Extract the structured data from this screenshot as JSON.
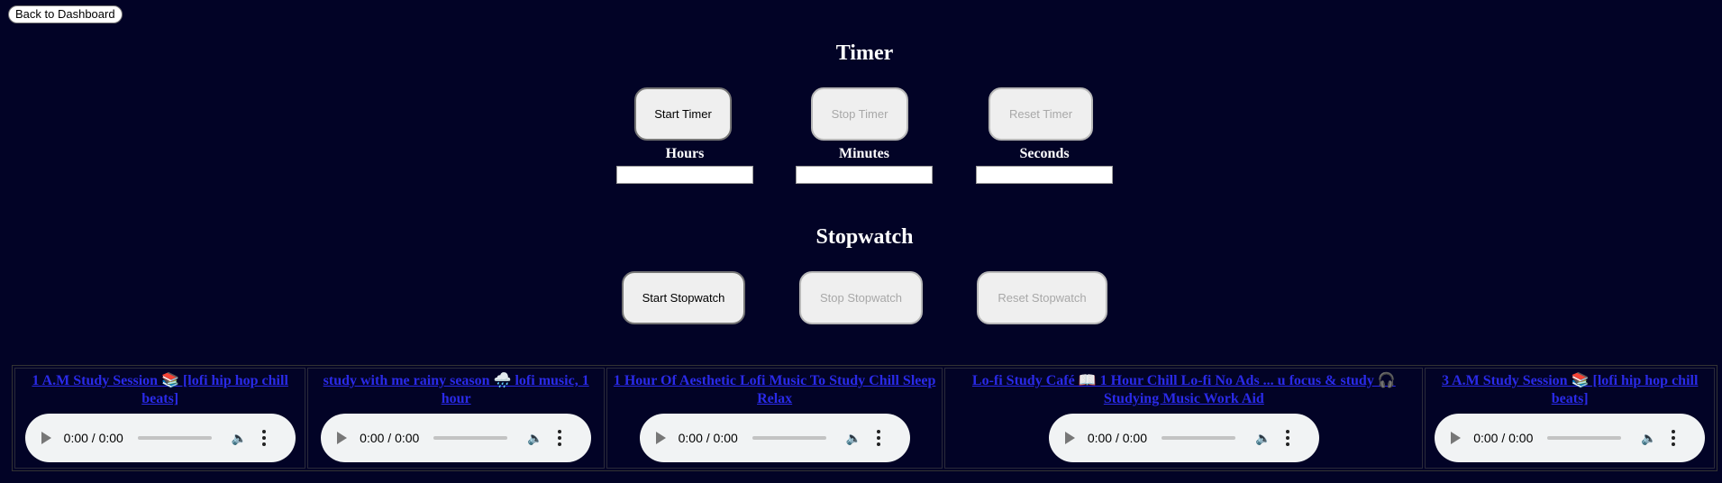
{
  "nav": {
    "back_label": "Back to Dashboard"
  },
  "timer": {
    "heading": "Timer",
    "start_label": "Start Timer",
    "stop_label": "Stop Timer",
    "reset_label": "Reset Timer",
    "hours_label": "Hours",
    "minutes_label": "Minutes",
    "seconds_label": "Seconds",
    "hours_value": "",
    "minutes_value": "",
    "seconds_value": ""
  },
  "stopwatch": {
    "heading": "Stopwatch",
    "start_label": "Start Stopwatch",
    "stop_label": "Stop Stopwatch",
    "reset_label": "Reset Stopwatch"
  },
  "tracks": [
    {
      "title": "1 A.M Study Session 📚 [lofi hip hop chill beats]",
      "time": "0:00 / 0:00"
    },
    {
      "title": "study with me rainy season 🌧️ lofi music, 1 hour",
      "time": "0:00 / 0:00"
    },
    {
      "title": "1 Hour Of Aesthetic Lofi Music To Study Chill Sleep Relax",
      "time": "0:00 / 0:00"
    },
    {
      "title": "Lo-fi Study Café 📖 1 Hour Chill Lo-fi No Ads ... u focus & study 🎧 Studying Music Work Aid",
      "time": "0:00 / 0:00"
    },
    {
      "title": "3 A.M Study Session 📚 [lofi hip hop chill beats]",
      "time": "0:00 / 0:00"
    }
  ],
  "icons": {
    "play": "play-icon",
    "volume": "volume-icon",
    "more": "more-options-icon"
  }
}
